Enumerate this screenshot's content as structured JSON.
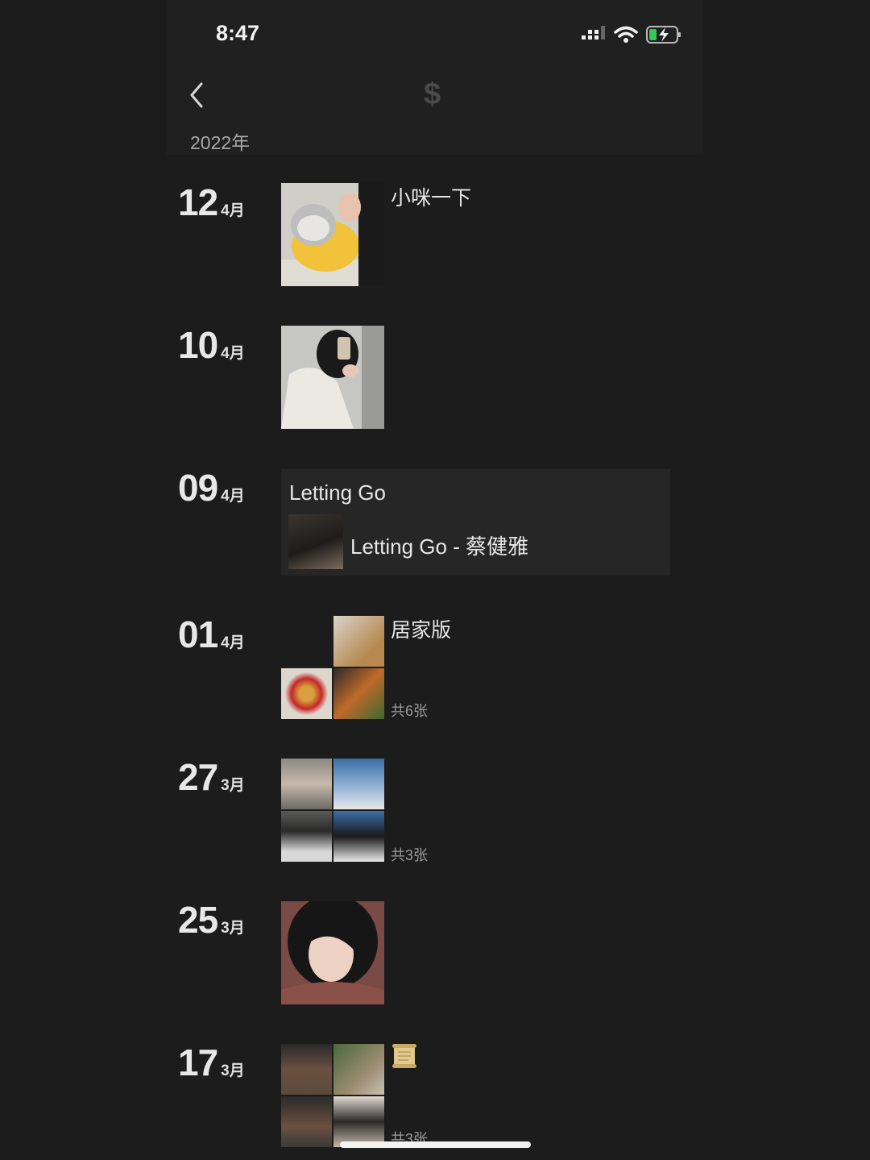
{
  "status": {
    "time": "8:47"
  },
  "header": {
    "year": "2022年",
    "center_icon": "$"
  },
  "entries": [
    {
      "day": "12",
      "month": "4月",
      "caption": "小咪一下"
    },
    {
      "day": "10",
      "month": "4月"
    },
    {
      "day": "09",
      "month": "4月",
      "music": {
        "title": "Letting Go",
        "track": "Letting Go - 蔡健雅"
      }
    },
    {
      "day": "01",
      "month": "4月",
      "caption": "居家版",
      "count": "共6张"
    },
    {
      "day": "27",
      "month": "3月",
      "count": "共3张"
    },
    {
      "day": "25",
      "month": "3月"
    },
    {
      "day": "17",
      "month": "3月",
      "caption_icon": "scroll-emoji",
      "count": "共3张"
    }
  ]
}
